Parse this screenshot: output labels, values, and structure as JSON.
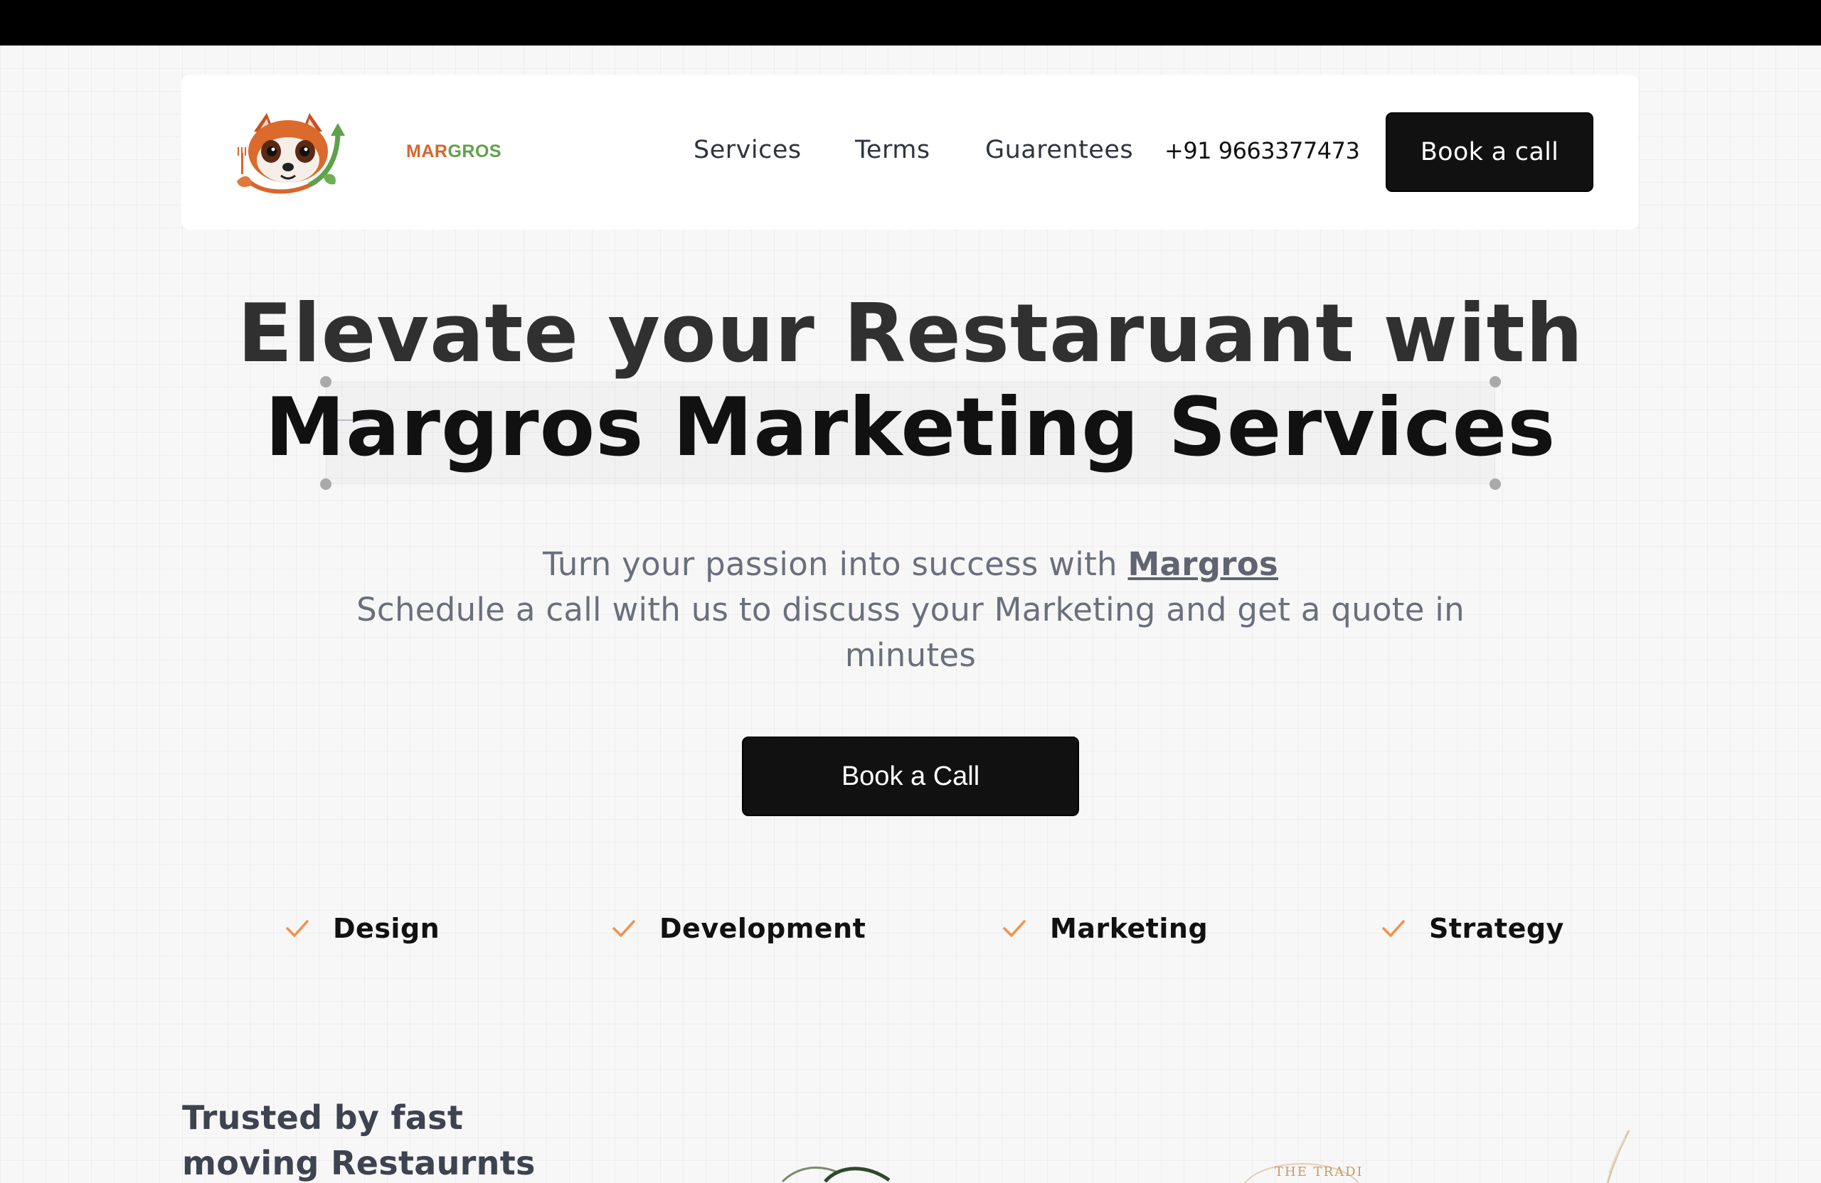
{
  "brand": {
    "name_part1": "MAR",
    "name_part2": "GROS",
    "colors": {
      "orange": "#d9652b",
      "green": "#5fa14a",
      "dark": "#111111",
      "accent_check": "#f0914a"
    }
  },
  "nav": {
    "links": [
      "Services",
      "Terms",
      "Guarentees"
    ],
    "phone": "+91 9663377473",
    "cta_label": "Book a call"
  },
  "hero": {
    "headline_line1": "Elevate your Restaruant with",
    "headline_line2": "Margros Marketing Services",
    "sub_prefix": "Turn your passion into success with ",
    "sub_link": "Margros",
    "sub_line2": "Schedule a call with us to discuss your Marketing and get a quote in minutes",
    "cta_label": "Book a Call"
  },
  "features": [
    "Design",
    "Development",
    "Marketing",
    "Strategy"
  ],
  "trusted": {
    "heading": "Trusted by fast moving Restaurnts",
    "partner_badge_text": "THE TRADI"
  }
}
